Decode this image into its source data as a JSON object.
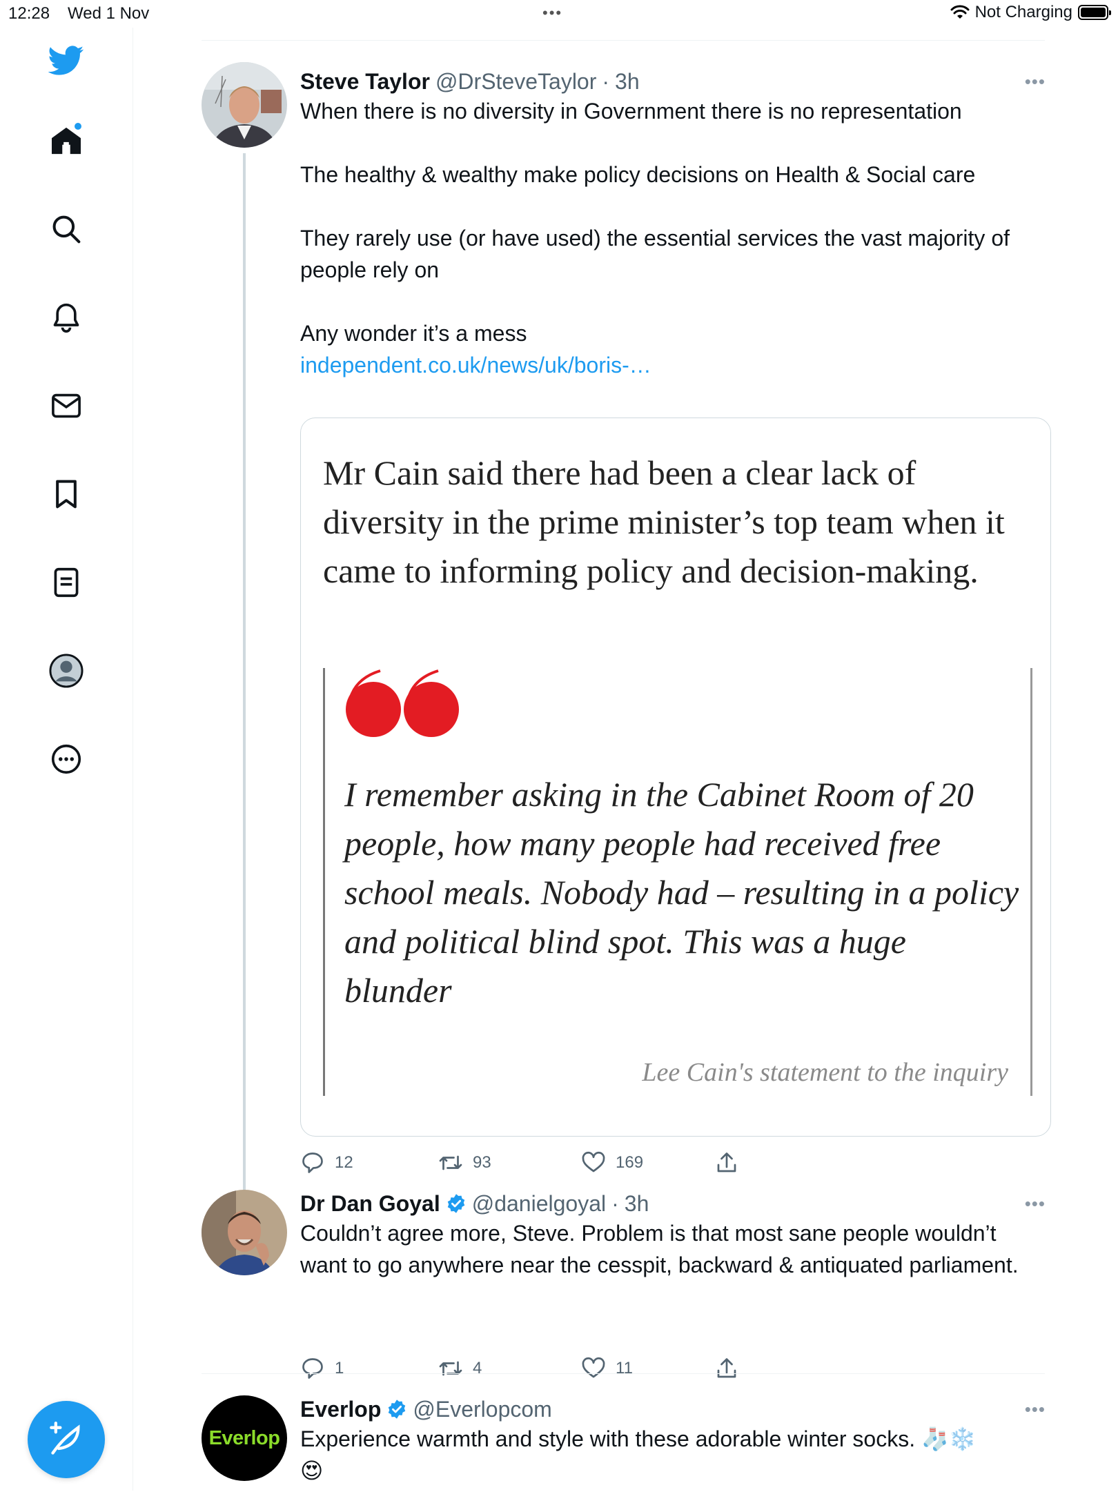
{
  "status_bar": {
    "time": "12:28",
    "date": "Wed 1 Nov",
    "multitask": "•••",
    "charging": "Not Charging"
  },
  "sidebar": {
    "items": [
      {
        "icon": "twitter-bird-icon"
      },
      {
        "icon": "home-icon",
        "has_notification": true
      },
      {
        "icon": "search-icon"
      },
      {
        "icon": "bell-icon"
      },
      {
        "icon": "mail-icon"
      },
      {
        "icon": "bookmark-icon"
      },
      {
        "icon": "lists-icon"
      },
      {
        "icon": "profile-icon"
      },
      {
        "icon": "more-circle-icon"
      }
    ],
    "compose": {
      "icon": "compose-feather-icon",
      "color": "#1d9bf0"
    }
  },
  "tweets": [
    {
      "name": "Steve Taylor",
      "handle": "@DrSteveTaylor",
      "sep": "·",
      "time": "3h",
      "more": "•••",
      "paragraphs": [
        "When there is no diversity in Government there is no representation",
        "The healthy & wealthy make policy decisions on Health & Social care",
        "They rarely use (or have used) the essential services the vast majority of people rely on",
        "Any wonder it’s a mess"
      ],
      "link": "independent.co.uk/news/uk/boris-…",
      "card": {
        "lead": "Mr Cain said there had been a clear lack of diversity in the prime minister’s top team when it came to informing policy and decision-making.",
        "quote": "I remember asking in the Cabinet Room of 20 people, how many people had received free school meals. Nobody had – resulting in a policy and political blind spot. This was a huge blunder",
        "citation": "Lee Cain's statement to the inquiry",
        "quote_mark_color": "#e31c23"
      },
      "replies": "12",
      "retweets": "93",
      "likes": "169"
    },
    {
      "name": "Dr Dan Goyal",
      "handle": "@danielgoyal",
      "sep": "·",
      "time": "3h",
      "more": "•••",
      "verified": true,
      "text": "Couldn’t agree more, Steve. Problem is that most sane people wouldn’t want to go anywhere near the cesspit, backward & antiquated parliament.",
      "replies": "1",
      "retweets": "4",
      "likes": "11"
    },
    {
      "name": "Everlop",
      "handle": "@Everlopcom",
      "more": "•••",
      "verified": true,
      "avatar_text": "Everlop",
      "text": "Experience warmth and style with these adorable winter socks. 🧦❄️",
      "emoji": "😍"
    }
  ],
  "colors": {
    "accent": "#1d9bf0",
    "secondary_text": "#536471",
    "border": "#cfd9de"
  }
}
